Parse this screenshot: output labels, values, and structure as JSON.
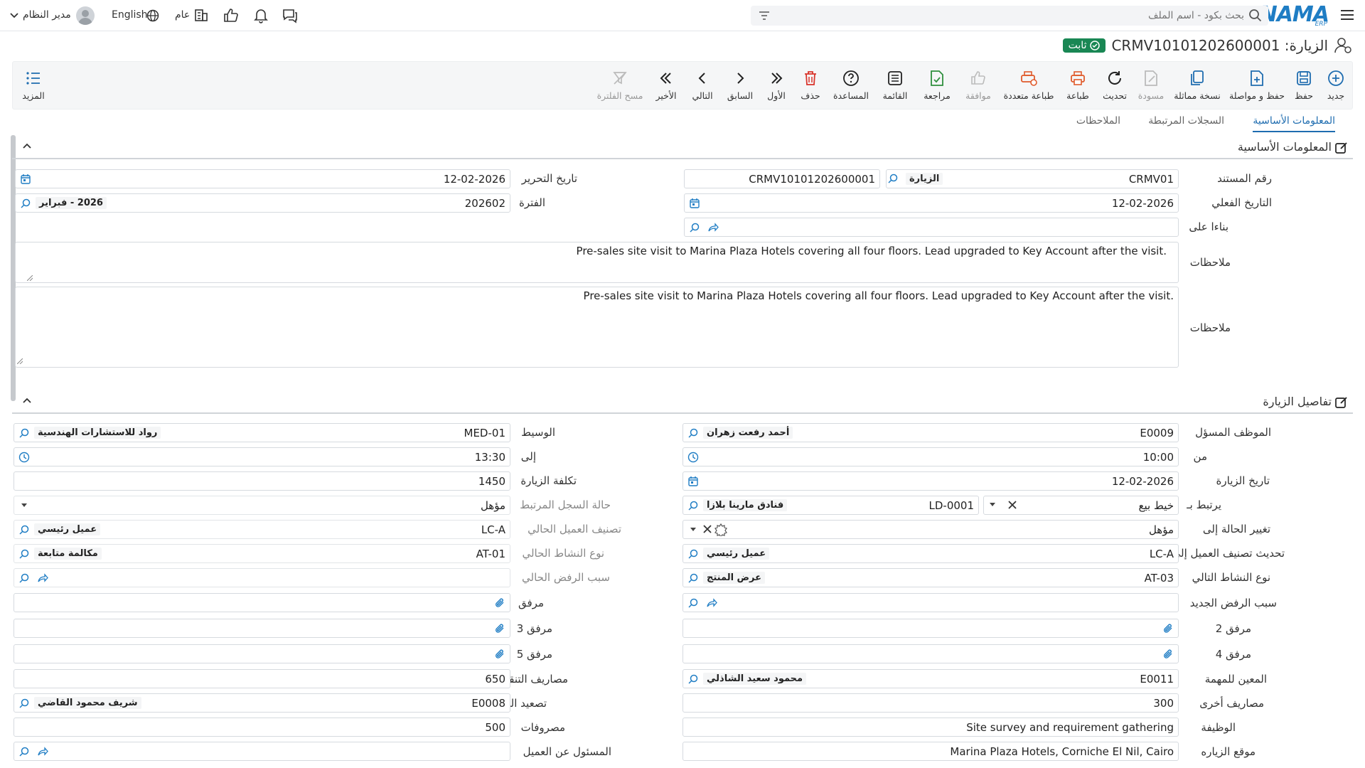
{
  "topbar": {
    "logo_main": "NAMA",
    "logo_sub": "ERP",
    "search_placeholder": "بحث بكود - اسم الملف",
    "language_en": "English",
    "language_ar": "عام",
    "user_name": "مدير النظام"
  },
  "title": {
    "text": "الزيارة: CRMV10101202600001",
    "badge": "ثابت",
    "badge_color": "#198754"
  },
  "toolbar": {
    "new": "جديد",
    "save": "حفظ",
    "save_continue": "حفظ و مواصلة",
    "copy": "نسخة مماثلة",
    "draft": "مسودة",
    "refresh": "تحديث",
    "print": "طباعة",
    "multi_print": "طباعة متعددة",
    "approve": "موافقة",
    "review": "مراجعة",
    "list": "القائمة",
    "help": "المساعدة",
    "delete": "حذف",
    "first": "الأول",
    "previous": "السابق",
    "next": "التالي",
    "last": "الأخير",
    "clear_filter": "مسح الفلترة",
    "more": "المزيد"
  },
  "tabs": {
    "basic": "المعلومات الأساسية",
    "related": "السجلات المرتبطة",
    "notes": "الملاحظات"
  },
  "section_basic": {
    "title": "المعلومات الأساسية",
    "doc_number_label": "رقم المستند",
    "doc_number_value": "CRMV01",
    "doc_type": "الزيارة",
    "doc_code": "CRMV10101202600001",
    "edit_date_label": "تاريخ التحرير",
    "edit_date_value": "12-02-2026",
    "actual_date_label": "التاريخ الفعلي",
    "actual_date_value": "12-02-2026",
    "period_label": "الفترة",
    "period_value": "202602",
    "period_name": "2026 - فبراير",
    "based_on_label": "بناءا على",
    "notes1_label": "ملاحظات",
    "notes1_value": "Pre-sales site visit to Marina Plaza Hotels covering all four floors. Lead upgraded to Key Account after the visit.",
    "notes2_label": "ملاحظات",
    "notes2_value": "Pre-sales site visit to Marina Plaza Hotels covering all four floors. Lead upgraded to Key Account after the visit."
  },
  "section_visit": {
    "title": "تفاصيل الزيارة",
    "employee_label": "الموظف المسؤل",
    "employee_code": "E0009",
    "employee_name": "أحمد رفعت زهران",
    "broker_label": "الوسيط",
    "broker_code": "MED-01",
    "broker_name": "رواد للاستشارات الهندسية",
    "from_label": "من",
    "from_value": "10:00",
    "to_label": "إلى",
    "to_value": "13:30",
    "visit_date_label": "تاريخ الزيارة",
    "visit_date_value": "12-02-2026",
    "visit_cost_label": "تكلفة الزيارة",
    "visit_cost_value": "1450",
    "linked_label": "يرتبط بـ",
    "linked_type": "خيط بيع",
    "linked_code": "LD-0001",
    "linked_name": "فنادق مارينا بلازا",
    "linked_status_label": "حالة السجل المرتبط",
    "linked_status_value": "مؤهل",
    "change_status_label": "تغيير الحالة إلى",
    "change_status_value": "مؤهل",
    "current_class_label": "تصنيف العميل الحالي",
    "current_class_code": "LC-A",
    "current_class_name": "عميل رئيسي",
    "update_class_label": "تحديث تصنيف العميل إلى",
    "update_class_code": "LC-A",
    "update_class_name": "عميل رئيسي",
    "current_activity_label": "نوع النشاط الحالي",
    "current_activity_code": "AT-01",
    "current_activity_name": "مكالمة متابعة",
    "next_activity_label": "نوع النشاط التالي",
    "next_activity_code": "AT-03",
    "next_activity_name": "عرض المنتج",
    "current_reject_label": "سبب الرفض الحالي",
    "new_reject_label": "سبب الرفض الجديد",
    "attach_label": "مرفق",
    "attach2_label": "مرفق 2",
    "attach3_label": "مرفق 3",
    "attach4_label": "مرفق 4",
    "attach5_label": "مرفق 5",
    "assignee_label": "المعين للمهمة",
    "assignee_code": "E0011",
    "assignee_name": "محمود سعيد الشاذلي",
    "travel_label": "مصاريف التنقل",
    "travel_value": "650",
    "other_exp_label": "مصاريف أخرى",
    "other_exp_value": "300",
    "escalate_label": "تصعيد الي",
    "escalate_code": "E0008",
    "escalate_name": "شريف محمود القاضي",
    "job_label": "الوظيفة",
    "job_value": "Site survey and requirement gathering",
    "expenses_label": "مصروفات",
    "expenses_value": "500",
    "location_label": "موقع الزياره",
    "location_value": "Marina Plaza Hotels, Corniche El Nil, Cairo",
    "customer_rep_label": "المسئول عن العميل"
  }
}
